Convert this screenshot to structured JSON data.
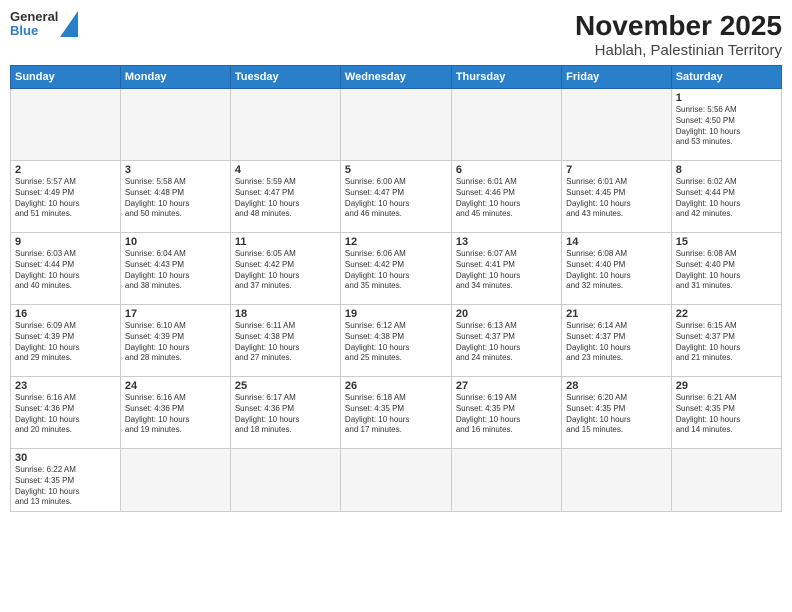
{
  "logo": {
    "line1": "General",
    "line2": "Blue"
  },
  "title": "November 2025",
  "subtitle": "Hablah, Palestinian Territory",
  "weekdays": [
    "Sunday",
    "Monday",
    "Tuesday",
    "Wednesday",
    "Thursday",
    "Friday",
    "Saturday"
  ],
  "weeks": [
    [
      {
        "num": "",
        "info": ""
      },
      {
        "num": "",
        "info": ""
      },
      {
        "num": "",
        "info": ""
      },
      {
        "num": "",
        "info": ""
      },
      {
        "num": "",
        "info": ""
      },
      {
        "num": "",
        "info": ""
      },
      {
        "num": "1",
        "info": "Sunrise: 5:56 AM\nSunset: 4:50 PM\nDaylight: 10 hours\nand 53 minutes."
      }
    ],
    [
      {
        "num": "2",
        "info": "Sunrise: 5:57 AM\nSunset: 4:49 PM\nDaylight: 10 hours\nand 51 minutes."
      },
      {
        "num": "3",
        "info": "Sunrise: 5:58 AM\nSunset: 4:48 PM\nDaylight: 10 hours\nand 50 minutes."
      },
      {
        "num": "4",
        "info": "Sunrise: 5:59 AM\nSunset: 4:47 PM\nDaylight: 10 hours\nand 48 minutes."
      },
      {
        "num": "5",
        "info": "Sunrise: 6:00 AM\nSunset: 4:47 PM\nDaylight: 10 hours\nand 46 minutes."
      },
      {
        "num": "6",
        "info": "Sunrise: 6:01 AM\nSunset: 4:46 PM\nDaylight: 10 hours\nand 45 minutes."
      },
      {
        "num": "7",
        "info": "Sunrise: 6:01 AM\nSunset: 4:45 PM\nDaylight: 10 hours\nand 43 minutes."
      },
      {
        "num": "8",
        "info": "Sunrise: 6:02 AM\nSunset: 4:44 PM\nDaylight: 10 hours\nand 42 minutes."
      }
    ],
    [
      {
        "num": "9",
        "info": "Sunrise: 6:03 AM\nSunset: 4:44 PM\nDaylight: 10 hours\nand 40 minutes."
      },
      {
        "num": "10",
        "info": "Sunrise: 6:04 AM\nSunset: 4:43 PM\nDaylight: 10 hours\nand 38 minutes."
      },
      {
        "num": "11",
        "info": "Sunrise: 6:05 AM\nSunset: 4:42 PM\nDaylight: 10 hours\nand 37 minutes."
      },
      {
        "num": "12",
        "info": "Sunrise: 6:06 AM\nSunset: 4:42 PM\nDaylight: 10 hours\nand 35 minutes."
      },
      {
        "num": "13",
        "info": "Sunrise: 6:07 AM\nSunset: 4:41 PM\nDaylight: 10 hours\nand 34 minutes."
      },
      {
        "num": "14",
        "info": "Sunrise: 6:08 AM\nSunset: 4:40 PM\nDaylight: 10 hours\nand 32 minutes."
      },
      {
        "num": "15",
        "info": "Sunrise: 6:08 AM\nSunset: 4:40 PM\nDaylight: 10 hours\nand 31 minutes."
      }
    ],
    [
      {
        "num": "16",
        "info": "Sunrise: 6:09 AM\nSunset: 4:39 PM\nDaylight: 10 hours\nand 29 minutes."
      },
      {
        "num": "17",
        "info": "Sunrise: 6:10 AM\nSunset: 4:39 PM\nDaylight: 10 hours\nand 28 minutes."
      },
      {
        "num": "18",
        "info": "Sunrise: 6:11 AM\nSunset: 4:38 PM\nDaylight: 10 hours\nand 27 minutes."
      },
      {
        "num": "19",
        "info": "Sunrise: 6:12 AM\nSunset: 4:38 PM\nDaylight: 10 hours\nand 25 minutes."
      },
      {
        "num": "20",
        "info": "Sunrise: 6:13 AM\nSunset: 4:37 PM\nDaylight: 10 hours\nand 24 minutes."
      },
      {
        "num": "21",
        "info": "Sunrise: 6:14 AM\nSunset: 4:37 PM\nDaylight: 10 hours\nand 23 minutes."
      },
      {
        "num": "22",
        "info": "Sunrise: 6:15 AM\nSunset: 4:37 PM\nDaylight: 10 hours\nand 21 minutes."
      }
    ],
    [
      {
        "num": "23",
        "info": "Sunrise: 6:16 AM\nSunset: 4:36 PM\nDaylight: 10 hours\nand 20 minutes."
      },
      {
        "num": "24",
        "info": "Sunrise: 6:16 AM\nSunset: 4:36 PM\nDaylight: 10 hours\nand 19 minutes."
      },
      {
        "num": "25",
        "info": "Sunrise: 6:17 AM\nSunset: 4:36 PM\nDaylight: 10 hours\nand 18 minutes."
      },
      {
        "num": "26",
        "info": "Sunrise: 6:18 AM\nSunset: 4:35 PM\nDaylight: 10 hours\nand 17 minutes."
      },
      {
        "num": "27",
        "info": "Sunrise: 6:19 AM\nSunset: 4:35 PM\nDaylight: 10 hours\nand 16 minutes."
      },
      {
        "num": "28",
        "info": "Sunrise: 6:20 AM\nSunset: 4:35 PM\nDaylight: 10 hours\nand 15 minutes."
      },
      {
        "num": "29",
        "info": "Sunrise: 6:21 AM\nSunset: 4:35 PM\nDaylight: 10 hours\nand 14 minutes."
      }
    ],
    [
      {
        "num": "30",
        "info": "Sunrise: 6:22 AM\nSunset: 4:35 PM\nDaylight: 10 hours\nand 13 minutes."
      },
      {
        "num": "",
        "info": ""
      },
      {
        "num": "",
        "info": ""
      },
      {
        "num": "",
        "info": ""
      },
      {
        "num": "",
        "info": ""
      },
      {
        "num": "",
        "info": ""
      },
      {
        "num": "",
        "info": ""
      }
    ]
  ]
}
